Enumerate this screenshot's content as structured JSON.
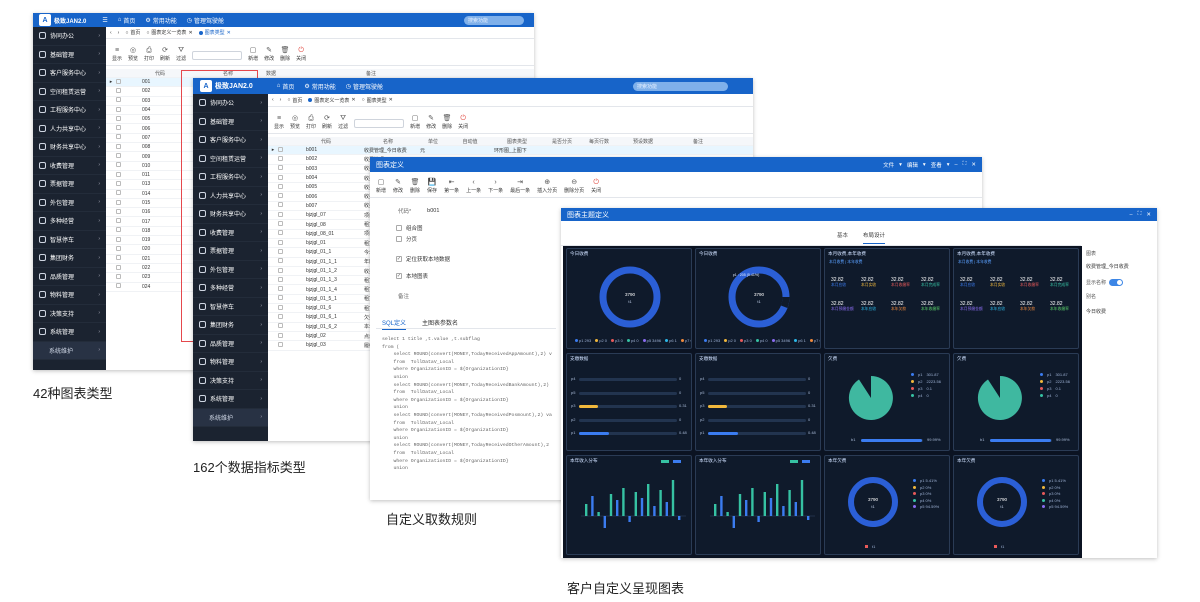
{
  "captions": {
    "c1": "42种图表类型",
    "c2": "162个数据指标类型",
    "c3": "自定义取数规则",
    "c4": "客户自定义呈现图表"
  },
  "app": {
    "logo": "极致JAN2.0",
    "nav_home": "首页",
    "nav_common": "常用功能",
    "nav_mgmt": "管理驾驶舱",
    "search_placeholder": "搜索功能"
  },
  "menu": [
    "协同办公",
    "基础管理",
    "客户服务中心",
    "空间租赁运营",
    "工程服务中心",
    "人力共享中心",
    "财务共享中心",
    "收费管理",
    "票据管理",
    "外包管理",
    "多种经营",
    "智慧停车",
    "集团财务",
    "品质管理",
    "物料管理",
    "决策支持",
    "系统管理"
  ],
  "menu_sub": "系统维护",
  "win1": {
    "tabs": [
      "首页",
      "图表定义一览表",
      "图表类型"
    ],
    "toolbar": [
      "显示",
      "预览",
      "打印",
      "刷新",
      "过滤",
      "新增",
      "修改",
      "删除",
      "关闭"
    ],
    "col_code": "代码",
    "col_name": "名称",
    "col_extra": "数据",
    "col_note": "备注",
    "codes": [
      "001",
      "002",
      "003",
      "004",
      "005",
      "006",
      "007",
      "008",
      "009",
      "010",
      "011",
      "013",
      "014",
      "015",
      "016",
      "017",
      "018",
      "019",
      "020",
      "021",
      "022",
      "023",
      "024"
    ]
  },
  "win2": {
    "tabs": [
      "首页",
      "图表定义一览表",
      "图表类型"
    ],
    "toolbar": [
      "显示",
      "预览",
      "打印",
      "刷新",
      "过滤",
      "新增",
      "修改",
      "删除",
      "关闭"
    ],
    "headers": [
      "代码",
      "名称",
      "单位",
      "自动值",
      "图表类型",
      "是否分页",
      "每页行数",
      "预设数据",
      "备注"
    ],
    "rows": [
      [
        "b001",
        "收费管理_今日收费",
        "元",
        "",
        "环形图_上图下"
      ],
      [
        "b002",
        "收费管理"
      ],
      [
        "b003",
        "收费管理"
      ],
      [
        "b004",
        "收费管理"
      ],
      [
        "b005",
        "收费管理"
      ],
      [
        "b006",
        "收费管理"
      ],
      [
        "b007",
        "收费管理"
      ],
      [
        "bjzjgl_07",
        "项目租赁"
      ],
      [
        "bjzjgl_08",
        "租赁情况"
      ],
      [
        "bjzjgl_08_01",
        "项目租赁"
      ],
      [
        "bjzjgl_01",
        "租赁面积"
      ],
      [
        "bjzjgl_01_1",
        "今年实收"
      ],
      [
        "bjzjgl_01_1_1",
        "年度收费"
      ],
      [
        "bjzjgl_01_1_2",
        "收费缴费"
      ],
      [
        "bjzjgl_01_1_3",
        "租赁缴费"
      ],
      [
        "bjzjgl_01_1_4",
        "租赁缴费"
      ],
      [
        "bjzjgl_01_5_1",
        "租赁缴费"
      ],
      [
        "bjzjgl_01_6",
        "租赁缴费"
      ],
      [
        "bjzjgl_01_6_1",
        "欠费情况"
      ],
      [
        "bjzjgl_01_6_2",
        "本年收费"
      ],
      [
        "bjzjgl_02",
        "点击缴费"
      ],
      [
        "bjzjgl_03",
        "履约合同"
      ]
    ]
  },
  "win3": {
    "title": "图表定义",
    "menus": [
      "文件",
      "编辑",
      "查看"
    ],
    "toolbar": [
      "新增",
      "修改",
      "删除",
      "保存",
      "第一条",
      "上一条",
      "下一条",
      "最后一条",
      "插入分页",
      "删除分页",
      "关闭"
    ],
    "code_label": "代码*",
    "code_value": "b001",
    "checks": [
      "组合图",
      "分页",
      "定位获取本地数据",
      "本地图表"
    ],
    "note_label": "备注",
    "tabs": [
      "SQL定义",
      "主图表参数名"
    ],
    "sql": "select 1 title ,t.value ,t.subflag\nfrom (\n    select ROUND(convert(MONEY,TodayReceivedAppAmount),2) v\n    from  TollDataV_Local\n    where OrganizationID = ${OrganizationID}\n    union\n    select ROUND(convert(MONEY,TodayReceivedBankAmount),2)\n    from  TollDataV_Local\n    where OrganizationID = ${OrganizationID}\n    union\n    select ROUND(convert(MONEY,TodayReceivedPosmount),2) va\n    from  TollDataV_Local\n    where OrganizationID = ${OrganizationID}\n    union\n    select ROUND(convert(MONEY,TodayReceivedOtherAmount),2\n    from  TollDataV_Local\n    where OrganizationID = ${OrganizationID}\n    union"
  },
  "win4": {
    "title": "图表主题定义",
    "tabs": [
      "基本",
      "布局设计"
    ],
    "side_labels": [
      "图表",
      "显示名称",
      "别名"
    ],
    "side_values": [
      "收费管理_今日收费",
      "今日收费"
    ],
    "panels": {
      "p1": "今日收费",
      "p2": "今日收费",
      "p3": "本月收费,本年收费",
      "p4": "本月收费,本年收费",
      "p5": "支缴数据",
      "p6": "支缴数据",
      "p7": "欠费",
      "p8": "欠费",
      "p9": "本年收入分布",
      "p10": "本年收入分布",
      "p11": "本年欠费",
      "p12": "本年欠费"
    },
    "donut_center": "3790",
    "donut_sub": "t1",
    "donut2_tip": "p1 : 205 (5.41%)",
    "kpi_value": "32.82",
    "kpi_labels": [
      "本月应收",
      "本月实收",
      "本月收缴率",
      "本月完成率",
      "本月预缴金额",
      "本年应收",
      "本年欠款",
      "本年收缴率"
    ],
    "bars": [
      [
        "p4",
        "0"
      ],
      [
        "p5",
        "0"
      ],
      [
        "p3",
        "0.31"
      ],
      [
        "p2",
        "0"
      ],
      [
        "p1",
        "0.48"
      ]
    ],
    "pie_legend": [
      [
        "p1",
        "301.87"
      ],
      [
        "p2",
        "2223.56"
      ],
      [
        "p3",
        "0.1"
      ],
      [
        "p4",
        "0"
      ]
    ],
    "pie_bar_label": "b1",
    "pie_bar_value": "99.99%",
    "donut3_legend": [
      "p1 5.41%",
      "p2 0%",
      "p3 0%",
      "p4 0%",
      "p5 94.59%"
    ],
    "donut3_foot": "t1"
  }
}
